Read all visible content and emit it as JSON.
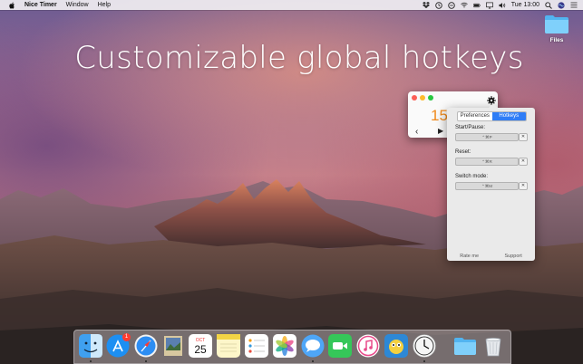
{
  "menubar": {
    "app_name": "Nice Timer",
    "items": [
      "Window",
      "Help"
    ],
    "clock": "Tue 13:00",
    "icons": [
      "dropbox-icon",
      "timer-icon",
      "history-icon",
      "wifi-icon",
      "battery-icon",
      "cast-icon",
      "volume-icon",
      "search-icon",
      "siri-icon",
      "notification-center-icon"
    ]
  },
  "headline": "Customizable global hotkeys",
  "desktop": {
    "files_label": "Files"
  },
  "timer": {
    "value": "15"
  },
  "preferences": {
    "tabs": [
      "Preferences",
      "Hotkeys"
    ],
    "active_tab": "Hotkeys",
    "fields": [
      {
        "label": "Start/Pause:",
        "value": "⌃⌘P",
        "clear": "✕"
      },
      {
        "label": "Reset:",
        "value": "⌃⌘R",
        "clear": "✕"
      },
      {
        "label": "Switch mode:",
        "value": "⌃⌘M",
        "clear": "✕"
      }
    ],
    "footer": [
      "Rate me",
      "Support"
    ]
  },
  "dock": {
    "apps": [
      "finder-icon",
      "app-store-icon",
      "safari-icon",
      "preview-icon",
      "calendar-icon",
      "notes-icon",
      "reminders-icon",
      "photos-icon",
      "messages-icon",
      "facetime-icon",
      "itunes-icon",
      "tweetbot-icon",
      "nice-timer-icon",
      "folder-icon",
      "trash-icon"
    ],
    "app_store_badge": "1",
    "calendar_month": "OCT",
    "calendar_day": "25"
  }
}
